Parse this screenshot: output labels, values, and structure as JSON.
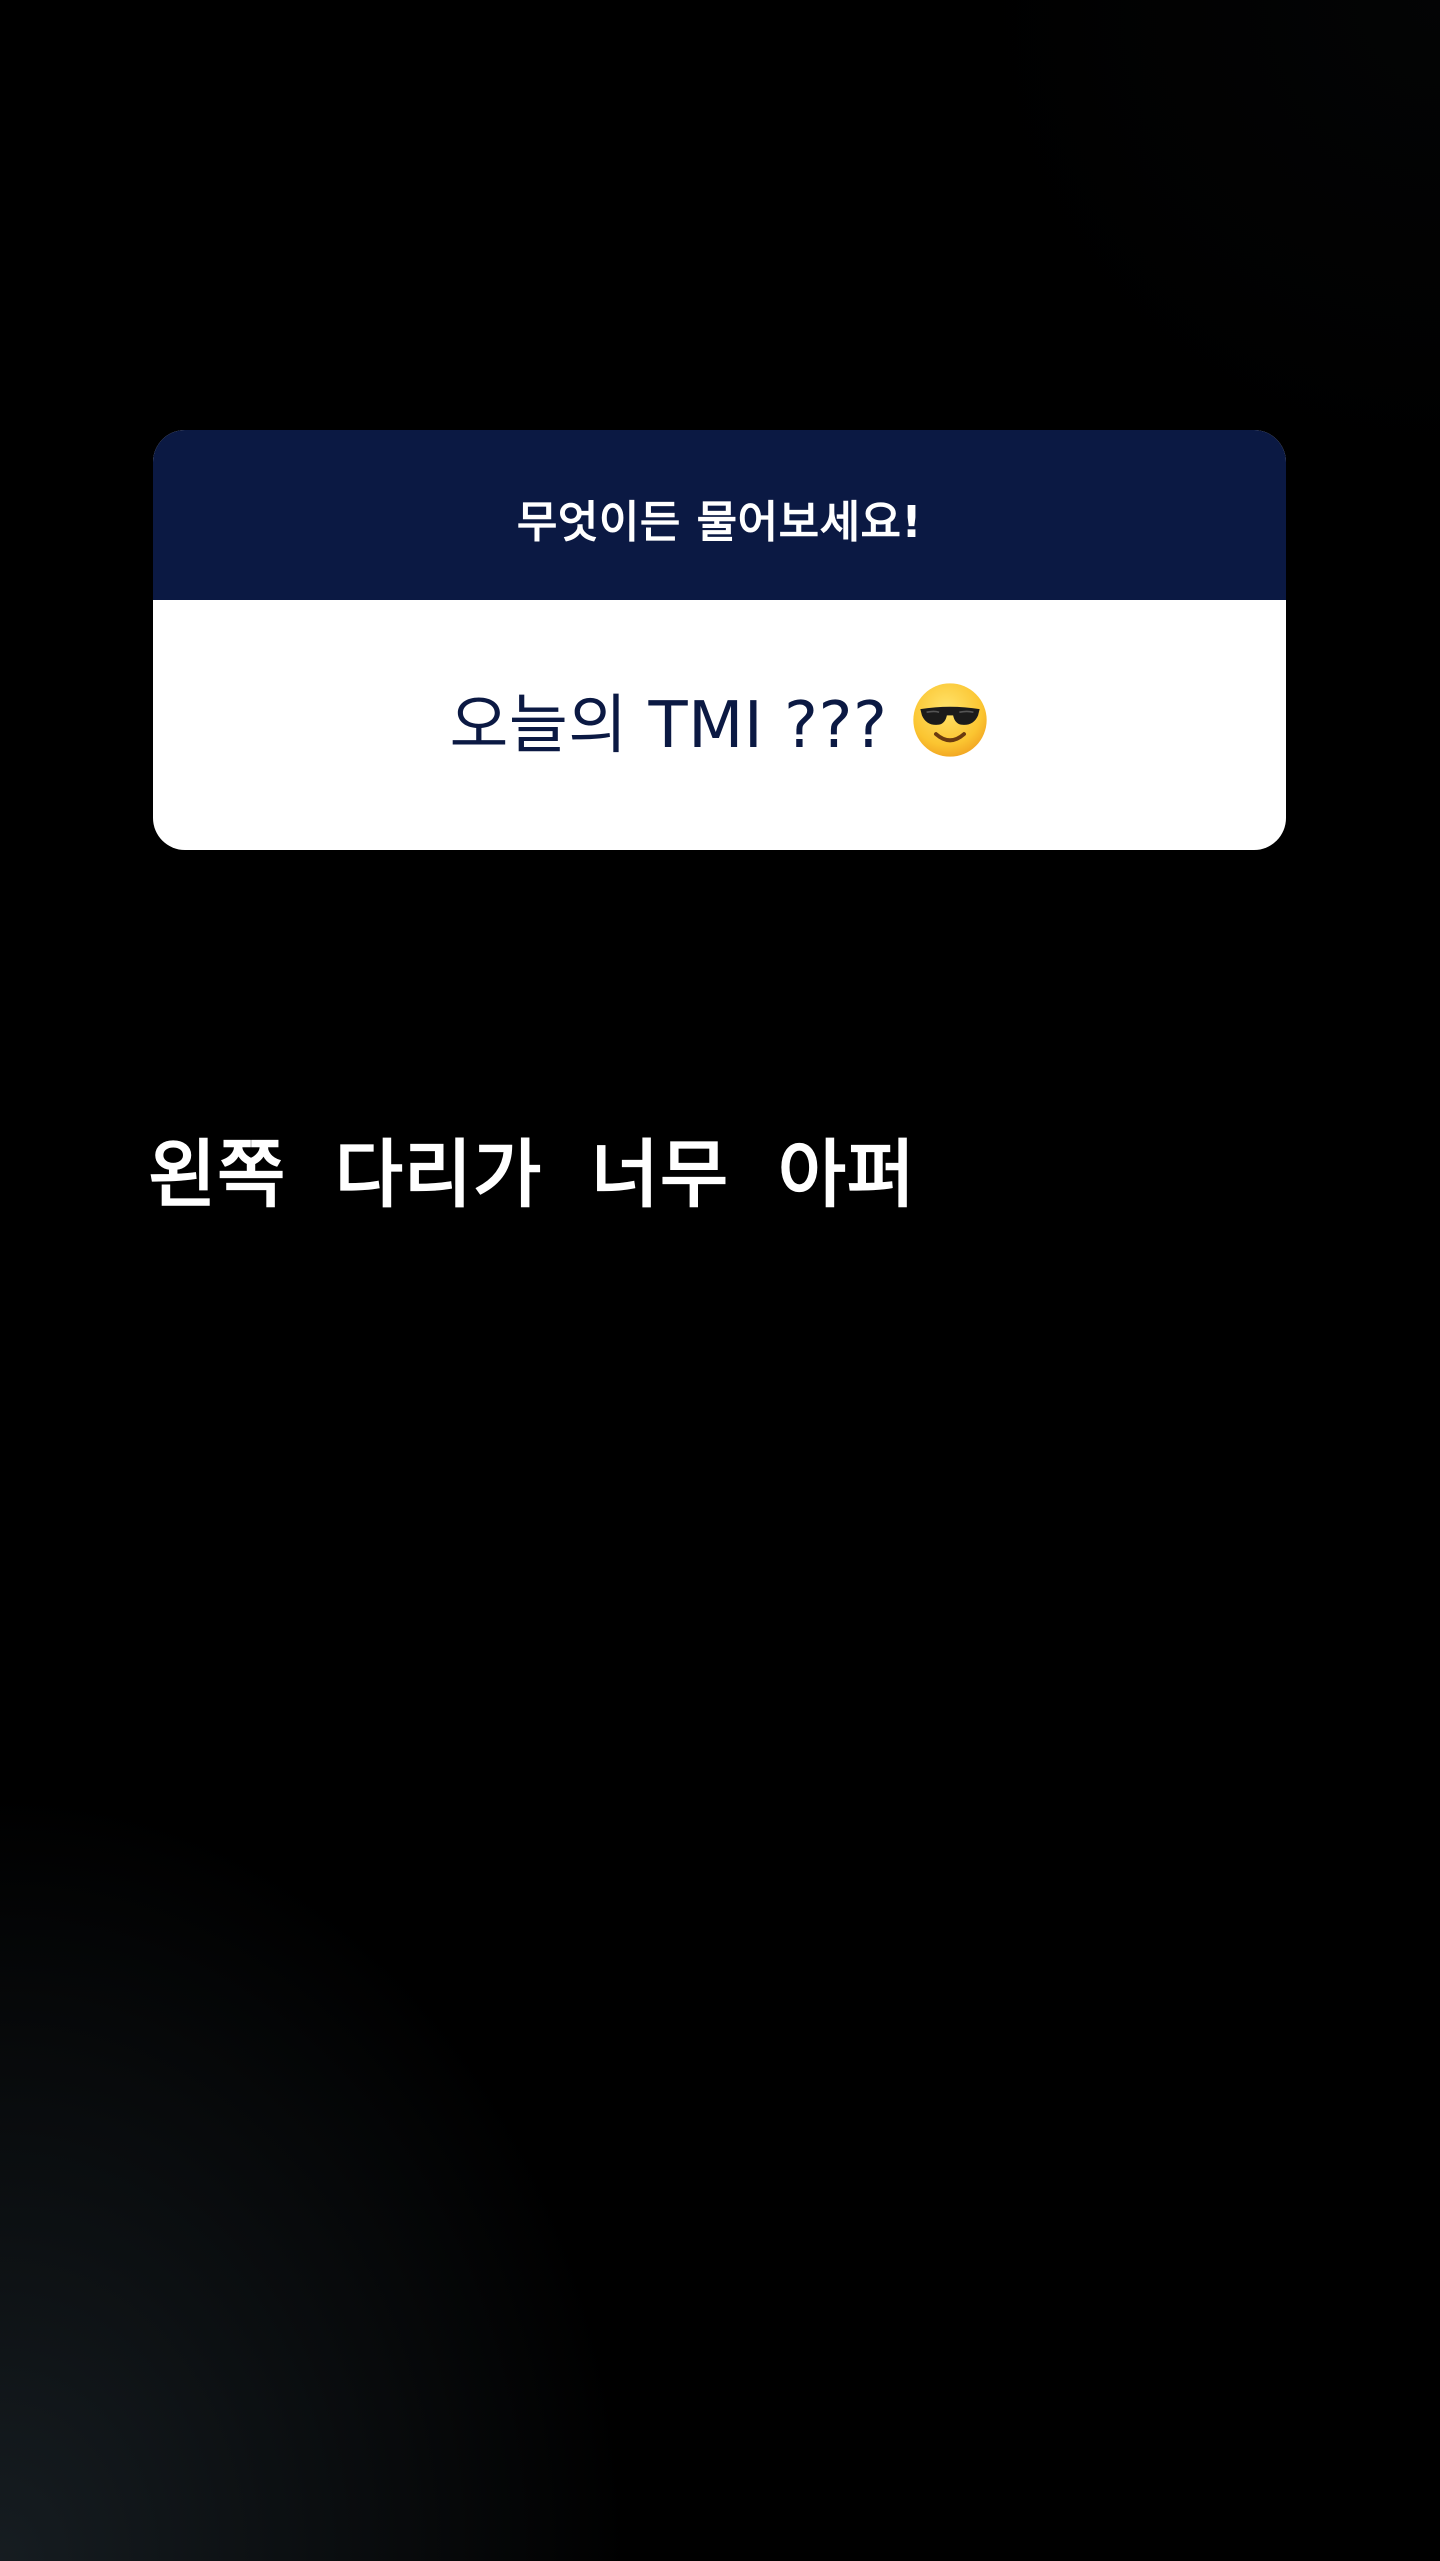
{
  "question_sticker": {
    "prompt": "무엇이든 물어보세요!",
    "question": "오늘의 TMI ???",
    "emoji_icon": "smiling-face-with-sunglasses-icon",
    "header_color": "#0b1943",
    "text_color": "#0b1943"
  },
  "answer": {
    "text": "왼쪽  다리가  너무  아퍼",
    "color": "#ffffff"
  },
  "colors": {
    "background": "#000000"
  }
}
